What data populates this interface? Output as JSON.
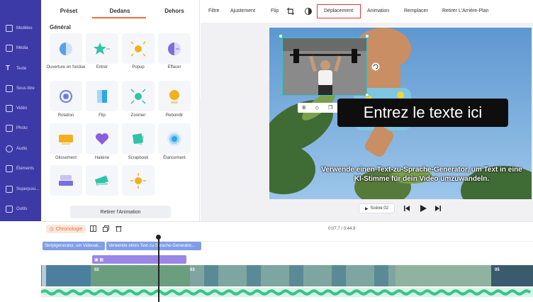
{
  "sidebar": {
    "items": [
      {
        "label": "Modèles",
        "icon": "layers-icon"
      },
      {
        "label": "Média",
        "icon": "media-icon"
      },
      {
        "label": "Texte",
        "icon": "text-icon"
      },
      {
        "label": "Sous-titre",
        "icon": "subtitle-icon"
      },
      {
        "label": "Vidéo",
        "icon": "video-icon"
      },
      {
        "label": "Photo",
        "icon": "photo-icon"
      },
      {
        "label": "Audio",
        "icon": "music-icon"
      },
      {
        "label": "Éléments",
        "icon": "elements-icon"
      },
      {
        "label": "Superposi...",
        "icon": "overlay-icon"
      },
      {
        "label": "Outils",
        "icon": "tools-icon"
      }
    ]
  },
  "panel": {
    "tabs": [
      "Préset",
      "Dedans",
      "Dehors"
    ],
    "active_tab": "Dedans",
    "section_title": "Général",
    "animations": [
      {
        "label": "Ouverture en fondue",
        "icon": "fade-icon",
        "color": "#5aa0e8"
      },
      {
        "label": "Entrer",
        "icon": "enter-star-icon",
        "color": "#2ec4a5"
      },
      {
        "label": "Popup",
        "icon": "popup-icon",
        "color": "#f2b01e"
      },
      {
        "label": "Effacer",
        "icon": "wipe-icon",
        "color": "#7a6ee0"
      },
      {
        "label": "Rotation",
        "icon": "rotate-icon",
        "color": "#6b7de0"
      },
      {
        "label": "Flip",
        "icon": "flip-icon",
        "color": "#2fa6e8"
      },
      {
        "label": "Zoomer",
        "icon": "zoom-icon",
        "color": "#2ec4a5"
      },
      {
        "label": "Rebondir",
        "icon": "bounce-icon",
        "color": "#f2b01e"
      },
      {
        "label": "Glissement",
        "icon": "slide-icon",
        "color": "#f2b01e"
      },
      {
        "label": "Haleine",
        "icon": "heart-icon",
        "color": "#8b5ee0"
      },
      {
        "label": "Scrapbook",
        "icon": "scrapbook-icon",
        "color": "#2ec4a5"
      },
      {
        "label": "Élancement",
        "icon": "pulse-icon",
        "color": "#2fa6e8"
      },
      {
        "label": "",
        "icon": "stack-icon",
        "color": "#7a6ee0"
      },
      {
        "label": "",
        "icon": "tilt-icon",
        "color": "#2ec4a5"
      },
      {
        "label": "",
        "icon": "burst-icon",
        "color": "#f2b01e"
      }
    ],
    "remove_button": "Retirer l'Animation"
  },
  "toolbar": {
    "filter": "Filtre",
    "adjust": "Ajustement",
    "flip": "Flip",
    "move": "Déplacement",
    "animation": "Animation",
    "replace": "Remplacer",
    "remove_bg": "Retirer L'Arrière-Plan"
  },
  "canvas": {
    "headline": "Entrez le texte ici",
    "subtitle": "Verwende einen Text-zu-Sprache-Generator, um Text in eine KI-Stimme für dein Video umzuwandeln.",
    "scene_label": "Scène 02"
  },
  "timeline": {
    "chrono_label": "Chronologie",
    "time": "0:07.7 / 0:44.9",
    "clip_1": "Skriptgenerator, um Videoak...",
    "clip_2": "Verwende einen Text-zu-Sprache-Generator...",
    "scene_numbers": [
      "02",
      "03",
      "05"
    ],
    "accent_color": "#e2703a"
  }
}
